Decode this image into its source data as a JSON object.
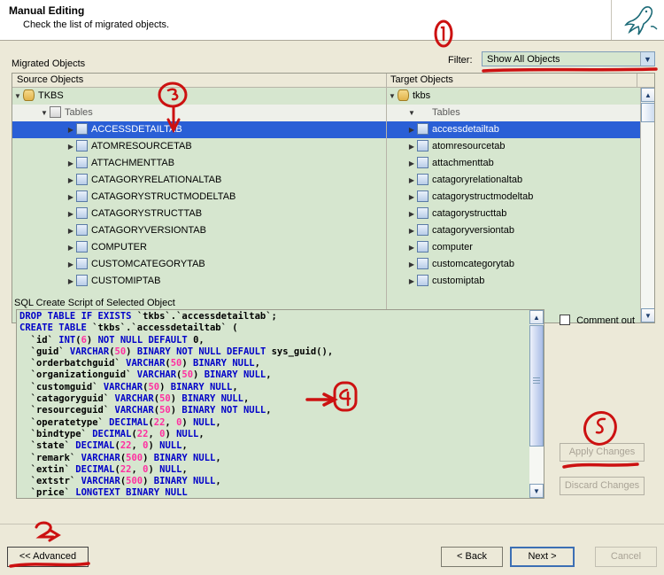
{
  "header": {
    "title": "Manual Editing",
    "subtitle": "Check the list of migrated objects.",
    "logo_icon": "mysql-dolphin-icon"
  },
  "toolbar": {
    "migrated_objects_label": "Migrated Objects",
    "filter_label": "Filter:",
    "filter_value": "Show All Objects",
    "filter_options": [
      "Show All Objects"
    ]
  },
  "tree": {
    "source_header": "Source Objects",
    "target_header": "Target Objects",
    "source_rows": [
      {
        "label": "TKBS",
        "indent": 1,
        "icon": "database-icon",
        "expander": "expanded",
        "selected": false,
        "dim": false
      },
      {
        "label": "Tables",
        "indent": 2,
        "icon": "folder-icon",
        "expander": "expanded",
        "selected": false,
        "dim": true
      },
      {
        "label": "ACCESSDETAILTAB",
        "indent": 3,
        "icon": "table-icon",
        "expander": "collapsed",
        "selected": true,
        "dim": false
      },
      {
        "label": "ATOMRESOURCETAB",
        "indent": 3,
        "icon": "table-icon",
        "expander": "collapsed",
        "selected": false,
        "dim": false
      },
      {
        "label": "ATTACHMENTTAB",
        "indent": 3,
        "icon": "table-icon",
        "expander": "collapsed",
        "selected": false,
        "dim": false
      },
      {
        "label": "CATAGORYRELATIONALTAB",
        "indent": 3,
        "icon": "table-icon",
        "expander": "collapsed",
        "selected": false,
        "dim": false
      },
      {
        "label": "CATAGORYSTRUCTMODELTAB",
        "indent": 3,
        "icon": "table-icon",
        "expander": "collapsed",
        "selected": false,
        "dim": false
      },
      {
        "label": "CATAGORYSTRUCTTAB",
        "indent": 3,
        "icon": "table-icon",
        "expander": "collapsed",
        "selected": false,
        "dim": false
      },
      {
        "label": "CATAGORYVERSIONTAB",
        "indent": 3,
        "icon": "table-icon",
        "expander": "collapsed",
        "selected": false,
        "dim": false
      },
      {
        "label": "COMPUTER",
        "indent": 3,
        "icon": "table-icon",
        "expander": "collapsed",
        "selected": false,
        "dim": false
      },
      {
        "label": "CUSTOMCATEGORYTAB",
        "indent": 3,
        "icon": "table-icon",
        "expander": "collapsed",
        "selected": false,
        "dim": false
      },
      {
        "label": "CUSTOMIPTAB",
        "indent": 3,
        "icon": "table-icon",
        "expander": "collapsed",
        "selected": false,
        "dim": false
      }
    ],
    "target_rows": [
      {
        "label": "tkbs",
        "indent": 1,
        "icon": "database-icon",
        "expander": "expanded",
        "selected": false,
        "dim": false
      },
      {
        "label": "Tables",
        "indent": 2,
        "icon": "none",
        "expander": "expanded",
        "selected": false,
        "dim": true
      },
      {
        "label": "accessdetailtab",
        "indent": 2,
        "icon": "table-icon",
        "expander": "collapsed",
        "selected": true,
        "dim": false
      },
      {
        "label": "atomresourcetab",
        "indent": 2,
        "icon": "table-icon",
        "expander": "collapsed",
        "selected": false,
        "dim": false
      },
      {
        "label": "attachmenttab",
        "indent": 2,
        "icon": "table-icon",
        "expander": "collapsed",
        "selected": false,
        "dim": false
      },
      {
        "label": "catagoryrelationaltab",
        "indent": 2,
        "icon": "table-icon",
        "expander": "collapsed",
        "selected": false,
        "dim": false
      },
      {
        "label": "catagorystructmodeltab",
        "indent": 2,
        "icon": "table-icon",
        "expander": "collapsed",
        "selected": false,
        "dim": false
      },
      {
        "label": "catagorystructtab",
        "indent": 2,
        "icon": "table-icon",
        "expander": "collapsed",
        "selected": false,
        "dim": false
      },
      {
        "label": "catagoryversiontab",
        "indent": 2,
        "icon": "table-icon",
        "expander": "collapsed",
        "selected": false,
        "dim": false
      },
      {
        "label": "computer",
        "indent": 2,
        "icon": "table-icon",
        "expander": "collapsed",
        "selected": false,
        "dim": false
      },
      {
        "label": "customcategorytab",
        "indent": 2,
        "icon": "table-icon",
        "expander": "collapsed",
        "selected": false,
        "dim": false
      },
      {
        "label": "customiptab",
        "indent": 2,
        "icon": "table-icon",
        "expander": "collapsed",
        "selected": false,
        "dim": false
      }
    ]
  },
  "sql": {
    "group_label": "SQL Create Script of Selected Object",
    "lines": [
      "DROP TABLE IF EXISTS `tkbs`.`accessdetailtab`;",
      "CREATE TABLE `tkbs`.`accessdetailtab` (",
      "  `id` INT(6) NOT NULL DEFAULT 0,",
      "  `guid` VARCHAR(50) BINARY NOT NULL DEFAULT sys_guid(),",
      "  `orderbatchguid` VARCHAR(50) BINARY NULL,",
      "  `organizationguid` VARCHAR(50) BINARY NULL,",
      "  `customguid` VARCHAR(50) BINARY NULL,",
      "  `catagoryguid` VARCHAR(50) BINARY NULL,",
      "  `resourceguid` VARCHAR(50) BINARY NOT NULL,",
      "  `operatetype` DECIMAL(22, 0) NULL,",
      "  `bindtype` DECIMAL(22, 0) NULL,",
      "  `state` DECIMAL(22, 0) NULL,",
      "  `remark` VARCHAR(500) BINARY NULL,",
      "  `extin` DECIMAL(22, 0) NULL,",
      "  `extstr` VARCHAR(500) BINARY NULL,",
      "  `price` LONGTEXT BINARY NULL"
    ],
    "comment_out_label": "Comment out",
    "comment_out_checked": false,
    "apply_changes_label": "Apply Changes",
    "discard_changes_label": "Discard Changes",
    "apply_enabled": false,
    "discard_enabled": false
  },
  "footer": {
    "advanced_label": "<< Advanced",
    "back_label": "< Back",
    "next_label": "Next >",
    "cancel_label": "Cancel",
    "cancel_enabled": false
  },
  "annotations": {
    "color": "#cc1111",
    "marks": [
      {
        "name": "circle-1-filter",
        "text": "1"
      },
      {
        "name": "circle-3-tree",
        "text": "3"
      },
      {
        "name": "circle-4-sql",
        "text": "4"
      },
      {
        "name": "circle-5-apply",
        "text": "5"
      },
      {
        "name": "circle-2-advanced",
        "text": "2"
      }
    ]
  }
}
